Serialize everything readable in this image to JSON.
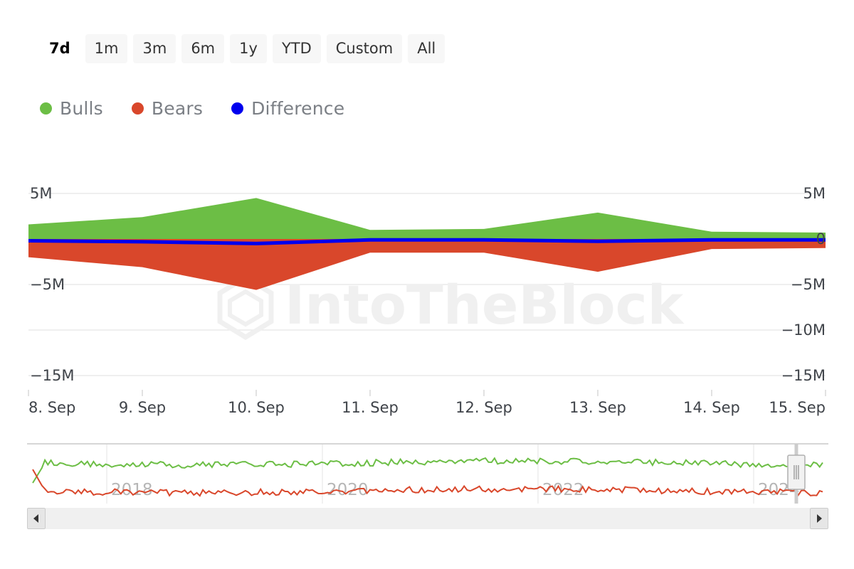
{
  "range_selector": {
    "buttons": [
      {
        "label": "7d",
        "selected": true
      },
      {
        "label": "1m",
        "selected": false
      },
      {
        "label": "3m",
        "selected": false
      },
      {
        "label": "6m",
        "selected": false
      },
      {
        "label": "1y",
        "selected": false
      },
      {
        "label": "YTD",
        "selected": false
      },
      {
        "label": "Custom",
        "selected": false
      },
      {
        "label": "All",
        "selected": false
      }
    ]
  },
  "legend": {
    "items": [
      {
        "label": "Bulls",
        "color": "#6cbe45"
      },
      {
        "label": "Bears",
        "color": "#d9472b"
      },
      {
        "label": "Difference",
        "color": "#0000ee"
      }
    ]
  },
  "watermark": {
    "text": "IntoTheBlock",
    "color": "#f0f0f0"
  },
  "colors": {
    "bulls": "#6cbe45",
    "bears": "#d9472b",
    "difference": "#0000ee",
    "gridline": "#eaeaea",
    "axis_text": "#3f4349",
    "legend_text": "#7b7f85",
    "nav_year_text": "#b6b6b6",
    "button_bg": "#f7f7f7"
  },
  "chart_data": {
    "type": "area",
    "title": "",
    "xlabel": "",
    "ylabel": "",
    "ylim": [
      -15000000,
      5000000
    ],
    "grid": true,
    "legend_position": "top-left",
    "y_axis_left_ticks": [
      "5M",
      "-5M",
      "-15M"
    ],
    "y_axis_right_ticks": [
      "5M",
      "0",
      "-5M",
      "-10M",
      "-15M"
    ],
    "y_tick_values": [
      5000000,
      0,
      -5000000,
      -10000000,
      -15000000
    ],
    "categories": [
      "8. Sep",
      "9. Sep",
      "10. Sep",
      "11. Sep",
      "12. Sep",
      "13. Sep",
      "14. Sep",
      "15. Sep"
    ],
    "series": [
      {
        "name": "Bulls",
        "color": "#6cbe45",
        "values": [
          1600000,
          2400000,
          4500000,
          1000000,
          1100000,
          2900000,
          800000,
          700000
        ]
      },
      {
        "name": "Bears",
        "color": "#d9472b",
        "values": [
          -2000000,
          -3100000,
          -5600000,
          -1500000,
          -1500000,
          -3600000,
          -1100000,
          -1000000
        ]
      },
      {
        "name": "Difference",
        "color": "#0000ee",
        "values": [
          -200000,
          -300000,
          -500000,
          -100000,
          -100000,
          -250000,
          -100000,
          -100000
        ]
      }
    ]
  },
  "navigator": {
    "year_labels": [
      "2018",
      "2020",
      "2022",
      "2024"
    ],
    "handle_position_pct": 96,
    "series": [
      {
        "name": "Bulls",
        "color": "#6cbe45"
      },
      {
        "name": "Bears",
        "color": "#d9472b"
      }
    ]
  },
  "scrollbar": {
    "left_arrow": "◀",
    "right_arrow": "▶"
  }
}
